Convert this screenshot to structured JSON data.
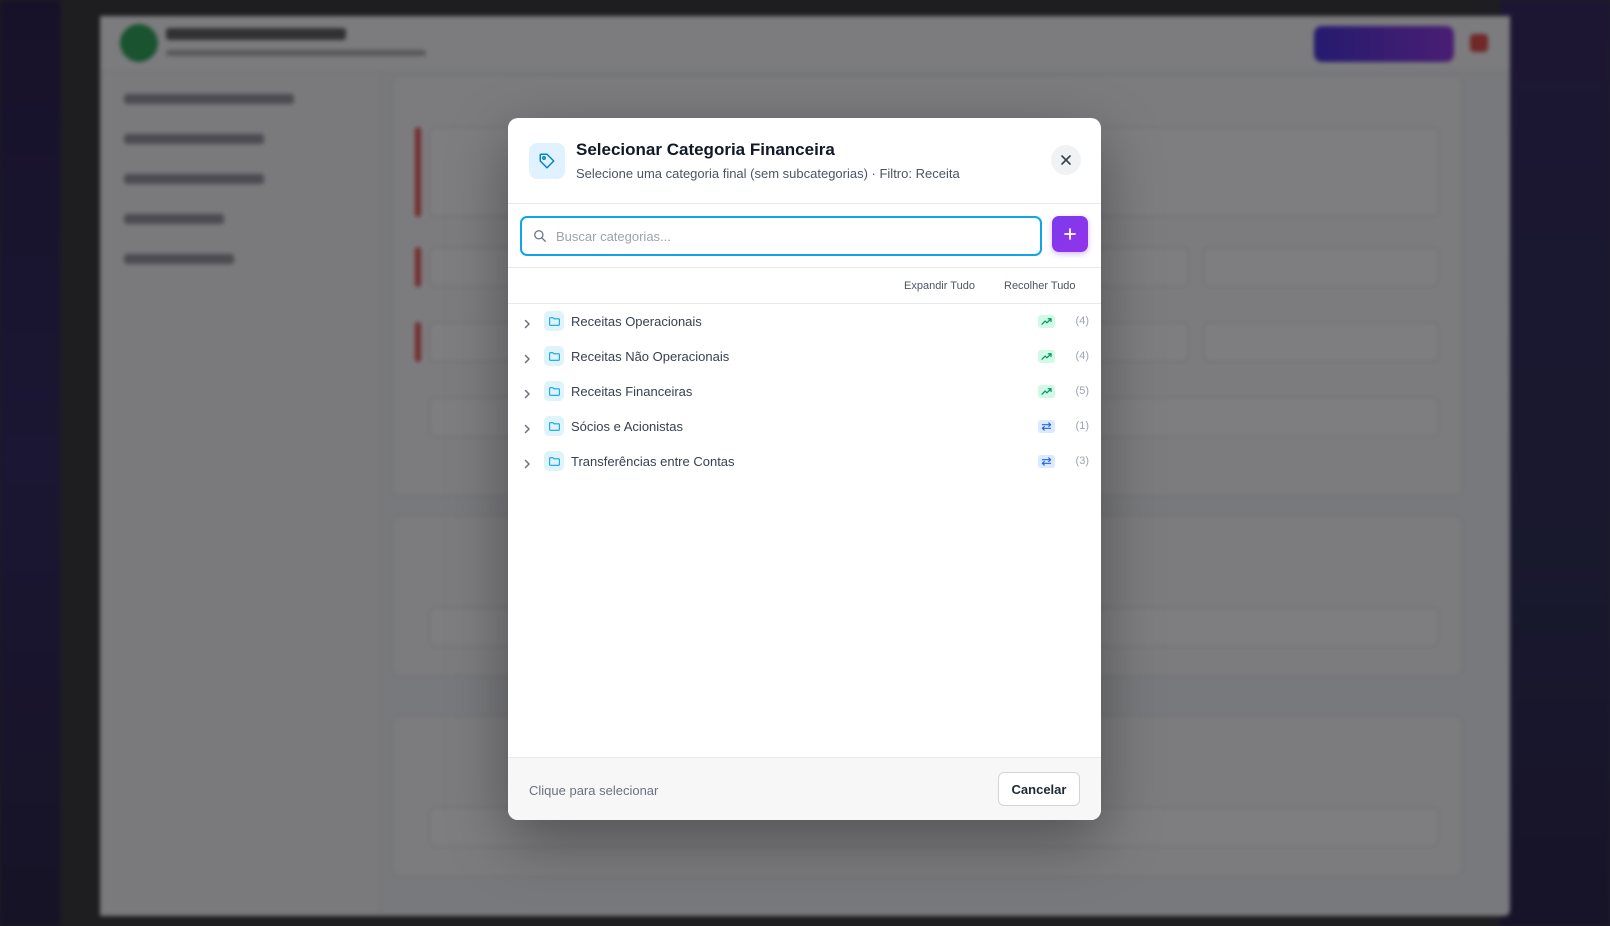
{
  "modal": {
    "title": "Selecionar Categoria Financeira",
    "subtitle": "Selecione uma categoria final (sem subcategorias) · Filtro: Receita",
    "header_icon": "tag-icon",
    "close_icon": "close-icon"
  },
  "search": {
    "placeholder": "Buscar categorias...",
    "value": "",
    "icon": "search-icon"
  },
  "add_button": {
    "icon": "plus-icon"
  },
  "tools": {
    "expand_all": "Expandir Tudo",
    "collapse_all": "Recolher Tudo"
  },
  "categories": [
    {
      "label": "Receitas Operacionais",
      "type": "revenue",
      "count": "(4)"
    },
    {
      "label": "Receitas Não Operacionais",
      "type": "revenue",
      "count": "(4)"
    },
    {
      "label": "Receitas Financeiras",
      "type": "revenue",
      "count": "(5)"
    },
    {
      "label": "Sócios e Acionistas",
      "type": "transfer",
      "count": "(1)"
    },
    {
      "label": "Transferências entre Contas",
      "type": "transfer",
      "count": "(3)"
    }
  ],
  "footer": {
    "hint": "Clique para selecionar",
    "cancel_label": "Cancelar"
  },
  "colors": {
    "accent": "#0ea5e9",
    "add_button": "#7c3aed",
    "revenue_badge": "#10b981",
    "transfer_badge": "#3b82f6",
    "folder": "#0ea5e9"
  }
}
